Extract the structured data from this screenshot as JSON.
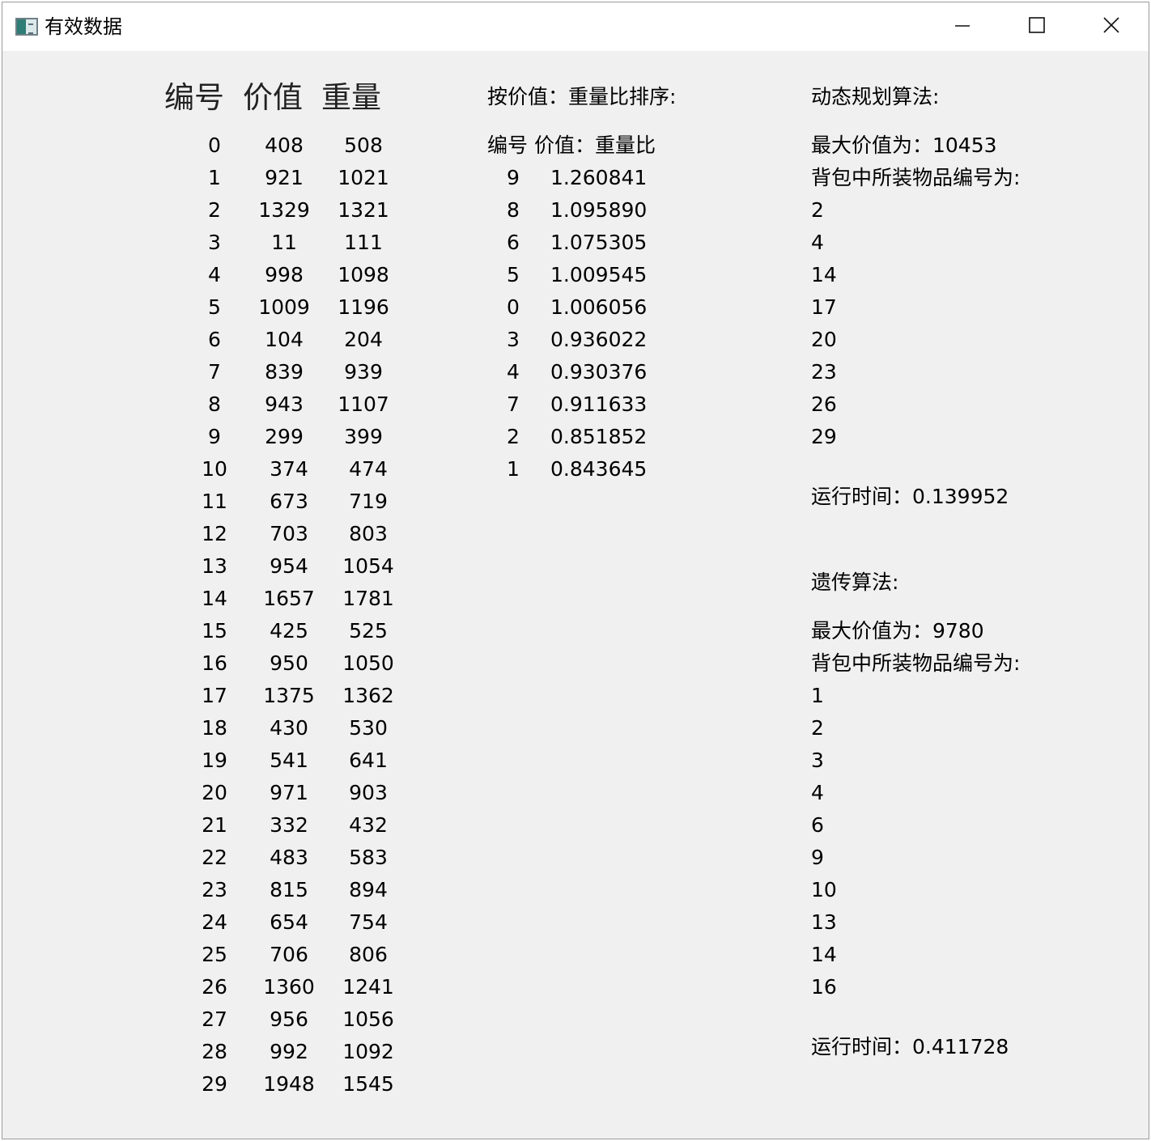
{
  "window": {
    "title": "有效数据",
    "icon": "app-window-icon",
    "controls": [
      "minimize-icon",
      "maximize-icon",
      "close-icon"
    ]
  },
  "data_table": {
    "headers": {
      "id": "编号",
      "value": "价值",
      "weight": "重量"
    },
    "rows": [
      [
        "0",
        "408",
        "508"
      ],
      [
        "1",
        "921",
        "1021"
      ],
      [
        "2",
        "1329",
        "1321"
      ],
      [
        "3",
        "11",
        "111"
      ],
      [
        "4",
        "998",
        "1098"
      ],
      [
        "5",
        "1009",
        "1196"
      ],
      [
        "6",
        "104",
        "204"
      ],
      [
        "7",
        "839",
        "939"
      ],
      [
        "8",
        "943",
        "1107"
      ],
      [
        "9",
        "299",
        "399"
      ],
      [
        "10",
        "374",
        "474"
      ],
      [
        "11",
        "673",
        "719"
      ],
      [
        "12",
        "703",
        "803"
      ],
      [
        "13",
        "954",
        "1054"
      ],
      [
        "14",
        "1657",
        "1781"
      ],
      [
        "15",
        "425",
        "525"
      ],
      [
        "16",
        "950",
        "1050"
      ],
      [
        "17",
        "1375",
        "1362"
      ],
      [
        "18",
        "430",
        "530"
      ],
      [
        "19",
        "541",
        "641"
      ],
      [
        "20",
        "971",
        "903"
      ],
      [
        "21",
        "332",
        "432"
      ],
      [
        "22",
        "483",
        "583"
      ],
      [
        "23",
        "815",
        "894"
      ],
      [
        "24",
        "654",
        "754"
      ],
      [
        "25",
        "706",
        "806"
      ],
      [
        "26",
        "1360",
        "1241"
      ],
      [
        "27",
        "956",
        "1056"
      ],
      [
        "28",
        "992",
        "1092"
      ],
      [
        "29",
        "1948",
        "1545"
      ]
    ]
  },
  "ratio_sort": {
    "title": "按价值：重量比排序:",
    "header": "编号  价值：重量比",
    "rows": [
      [
        "9",
        "1.260841"
      ],
      [
        "8",
        "1.095890"
      ],
      [
        "6",
        "1.075305"
      ],
      [
        "5",
        "1.009545"
      ],
      [
        "0",
        "1.006056"
      ],
      [
        "3",
        "0.936022"
      ],
      [
        "4",
        "0.930376"
      ],
      [
        "7",
        "0.911633"
      ],
      [
        "2",
        "0.851852"
      ],
      [
        "1",
        "0.843645"
      ]
    ]
  },
  "dynamic_programming": {
    "title": "动态规划算法:",
    "max_value": "最大价值为：10453",
    "items_label": "背包中所装物品编号为:",
    "items": [
      "2",
      "4",
      "14",
      "17",
      "20",
      "23",
      "26",
      "29"
    ],
    "runtime": "运行时间：0.139952"
  },
  "genetic": {
    "title": "遗传算法:",
    "max_value": "最大价值为：9780",
    "items_label": "背包中所装物品编号为:",
    "items": [
      "1",
      "2",
      "3",
      "4",
      "6",
      "9",
      "10",
      "13",
      "14",
      "16"
    ],
    "runtime": "运行时间：0.411728"
  }
}
